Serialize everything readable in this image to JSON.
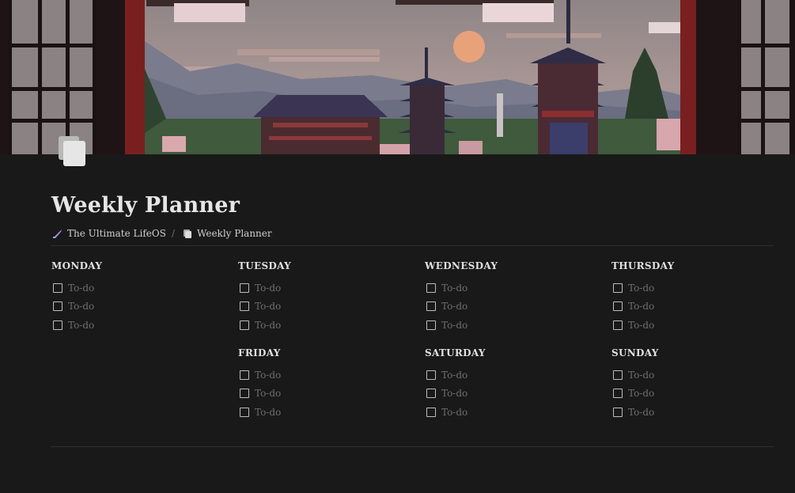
{
  "page": {
    "title": "Weekly Planner"
  },
  "breadcrumb": [
    {
      "label": "The Ultimate LifeOS",
      "icon": "rocket-icon"
    },
    {
      "label": "Weekly Planner",
      "icon": "pages-icon"
    }
  ],
  "days": [
    {
      "name": "MONDAY",
      "todos": [
        "To-do",
        "To-do",
        "To-do"
      ]
    },
    {
      "name": "TUESDAY",
      "todos": [
        "To-do",
        "To-do",
        "To-do"
      ]
    },
    {
      "name": "WEDNESDAY",
      "todos": [
        "To-do",
        "To-do",
        "To-do"
      ]
    },
    {
      "name": "THURSDAY",
      "todos": [
        "To-do",
        "To-do",
        "To-do"
      ]
    },
    {
      "name": "FRIDAY",
      "todos": [
        "To-do",
        "To-do",
        "To-do"
      ]
    },
    {
      "name": "SATURDAY",
      "todos": [
        "To-do",
        "To-do",
        "To-do"
      ]
    },
    {
      "name": "SUNDAY",
      "todos": [
        "To-do",
        "To-do",
        "To-do"
      ]
    }
  ],
  "colors": {
    "background": "#191919",
    "text": "#d4d4d4",
    "placeholder": "#6e6e6e"
  }
}
